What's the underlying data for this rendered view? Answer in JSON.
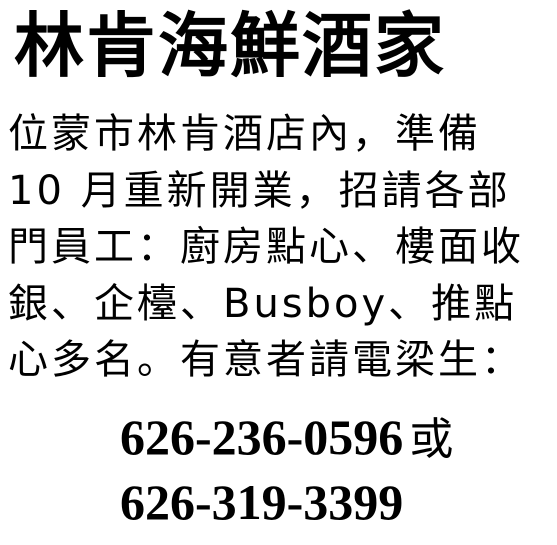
{
  "ad": {
    "title": "林肯海鮮酒家",
    "body_lines": [
      "位蒙市林肯酒店內，準備",
      "10 月重新開業，招請各部",
      "門員工：廚房點心、樓面收",
      "銀、企檯、Busboy、推點",
      "心多名。有意者請電梁生："
    ],
    "phone_1": "626-236-0596",
    "or_label": "或",
    "phone_2": "626-319-3399"
  }
}
